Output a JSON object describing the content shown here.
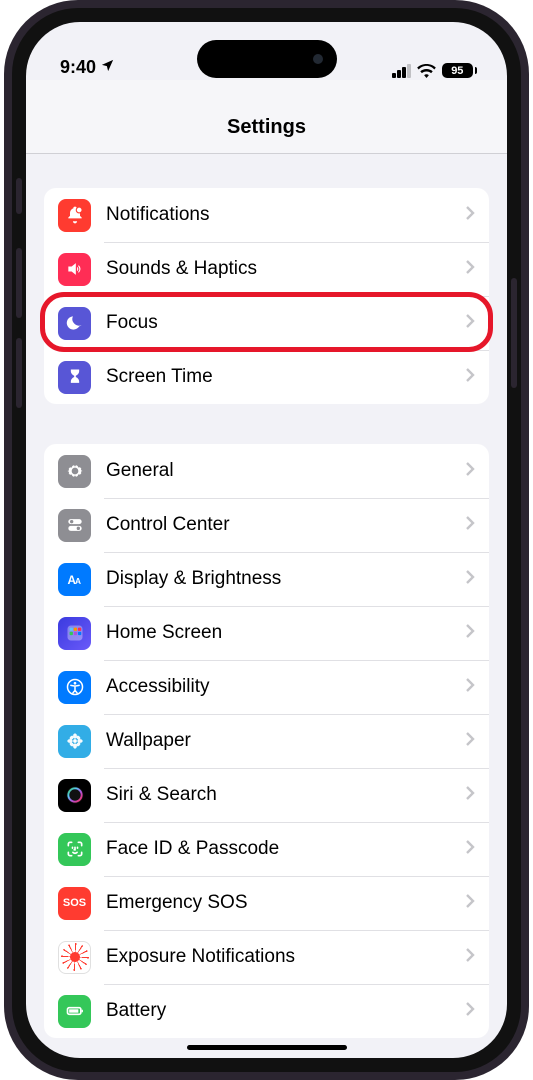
{
  "status": {
    "time": "9:40",
    "battery_pct": "95"
  },
  "header": {
    "title": "Settings"
  },
  "group1": {
    "items": [
      {
        "label": "Notifications",
        "icon": "bell-icon",
        "color": "bg-red"
      },
      {
        "label": "Sounds & Haptics",
        "icon": "speaker-icon",
        "color": "bg-pink"
      },
      {
        "label": "Focus",
        "icon": "moon-icon",
        "color": "bg-indigo",
        "highlighted": true
      },
      {
        "label": "Screen Time",
        "icon": "hourglass-icon",
        "color": "bg-indigo"
      }
    ]
  },
  "group2": {
    "items": [
      {
        "label": "General",
        "icon": "gear-icon",
        "color": "bg-gray"
      },
      {
        "label": "Control Center",
        "icon": "toggles-icon",
        "color": "bg-gray"
      },
      {
        "label": "Display & Brightness",
        "icon": "text-size-icon",
        "color": "bg-blue"
      },
      {
        "label": "Home Screen",
        "icon": "grid-icon",
        "color": "bg-indigo"
      },
      {
        "label": "Accessibility",
        "icon": "accessibility-icon",
        "color": "bg-blue"
      },
      {
        "label": "Wallpaper",
        "icon": "flower-icon",
        "color": "bg-cyan"
      },
      {
        "label": "Siri & Search",
        "icon": "siri-icon",
        "color": "bg-black"
      },
      {
        "label": "Face ID & Passcode",
        "icon": "faceid-icon",
        "color": "bg-green"
      },
      {
        "label": "Emergency SOS",
        "icon": "sos-icon",
        "color": "bg-red"
      },
      {
        "label": "Exposure Notifications",
        "icon": "exposure-icon",
        "color": "bg-white"
      },
      {
        "label": "Battery",
        "icon": "battery-icon",
        "color": "bg-green"
      }
    ]
  }
}
